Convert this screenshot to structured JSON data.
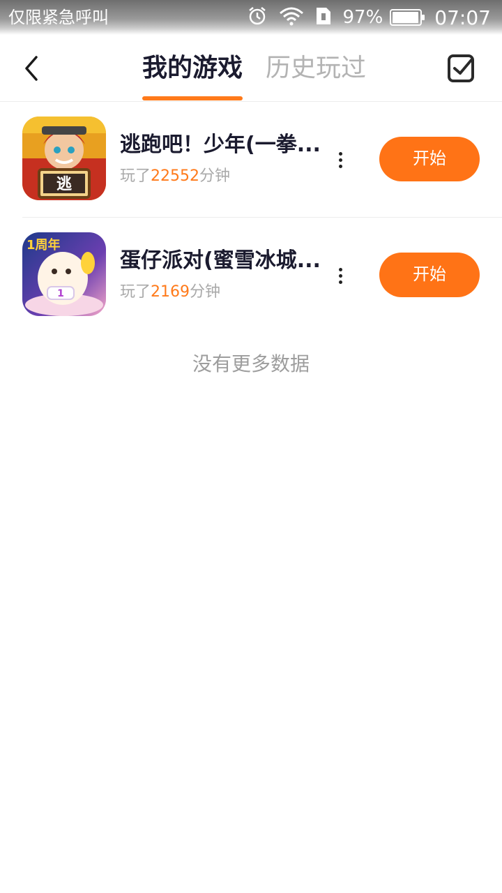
{
  "status_bar": {
    "carrier": "仅限紧急呼叫",
    "battery_percent": "97%",
    "battery_level": 0.97,
    "time": "07:07",
    "icons": [
      "alarm-icon",
      "wifi-icon",
      "sim-icon",
      "battery-icon"
    ]
  },
  "nav": {
    "tabs": [
      {
        "label": "我的游戏",
        "active": true
      },
      {
        "label": "历史玩过",
        "active": false
      }
    ],
    "back_icon": "back-arrow-icon",
    "select_icon": "checkbox-icon"
  },
  "games": [
    {
      "title": "逃跑吧！少年(一拳...",
      "played_prefix": "玩了",
      "played_minutes": "22552",
      "played_suffix": "分钟",
      "start_label": "开始",
      "icon": "game-icon-taopaoba"
    },
    {
      "title": "蛋仔派对(蜜雪冰城...",
      "played_prefix": "玩了",
      "played_minutes": "2169",
      "played_suffix": "分钟",
      "start_label": "开始",
      "icon": "game-icon-danzai"
    }
  ],
  "footer": {
    "text": "没有更多数据"
  },
  "colors": {
    "accent": "#ff7316",
    "title": "#1b1b2f",
    "muted": "#a9a9a9"
  }
}
